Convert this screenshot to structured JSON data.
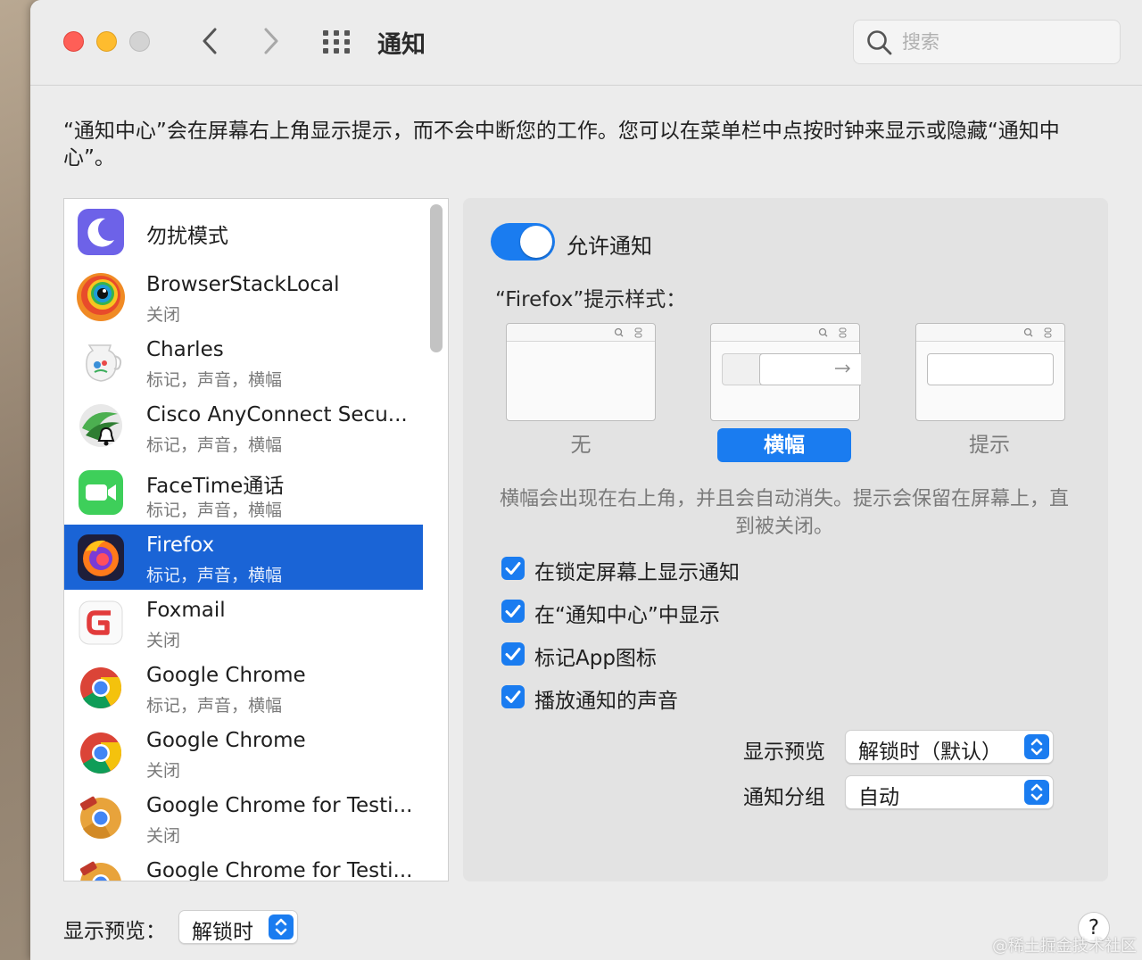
{
  "window": {
    "title": "通知",
    "search_placeholder": "搜索"
  },
  "description": "“通知中心”会在屏幕右上角显示提示，而不会中断您的工作。您可以在菜单栏中点按时钟来显示或隐藏“通知中心”。",
  "apps": [
    {
      "name": "勿扰模式",
      "sub": "",
      "icon": "moon-icon"
    },
    {
      "name": "BrowserStackLocal",
      "sub": "关闭",
      "icon": "browserstack-icon"
    },
    {
      "name": "Charles",
      "sub": "标记，声音，横幅",
      "icon": "charles-jug-icon"
    },
    {
      "name": "Cisco AnyConnect Secu...",
      "sub": "标记，声音，横幅",
      "icon": "cisco-icon"
    },
    {
      "name": "FaceTime通话",
      "sub": "标记，声音，横幅",
      "icon": "facetime-icon"
    },
    {
      "name": "Firefox",
      "sub": "标记，声音，横幅",
      "icon": "firefox-icon"
    },
    {
      "name": "Foxmail",
      "sub": "关闭",
      "icon": "foxmail-icon"
    },
    {
      "name": "Google Chrome",
      "sub": "标记，声音，横幅",
      "icon": "chrome-icon"
    },
    {
      "name": "Google Chrome",
      "sub": "关闭",
      "icon": "chrome-icon"
    },
    {
      "name": "Google Chrome for Testi...",
      "sub": "关闭",
      "icon": "chrome-test-icon"
    },
    {
      "name": "Google Chrome for Testi...",
      "sub": "",
      "icon": "chrome-test-icon"
    }
  ],
  "detail": {
    "allow_label": "允许通知",
    "allow_on": true,
    "style_label": "“Firefox”提示样式：",
    "styles": [
      {
        "label": "无"
      },
      {
        "label": "横幅"
      },
      {
        "label": "提示"
      }
    ],
    "selected_style": "横幅",
    "style_note": "横幅会出现在右上角，并且会自动消失。提示会保留在屏幕上，直到被关闭。",
    "checks": [
      {
        "label": "在锁定屏幕上显示通知",
        "checked": true
      },
      {
        "label": "在“通知中心”中显示",
        "checked": true
      },
      {
        "label": "标记App图标",
        "checked": true
      },
      {
        "label": "播放通知的声音",
        "checked": true
      }
    ],
    "preview_label": "显示预览",
    "preview_value": "解锁时（默认）",
    "group_label": "通知分组",
    "group_value": "自动"
  },
  "bottom": {
    "preview_label": "显示预览：",
    "preview_value": "解锁时"
  },
  "help_label": "?",
  "watermark": "@稀土掘金技术社区",
  "colors": {
    "accent": "#1a7cf0",
    "selection": "#1a64d6"
  }
}
